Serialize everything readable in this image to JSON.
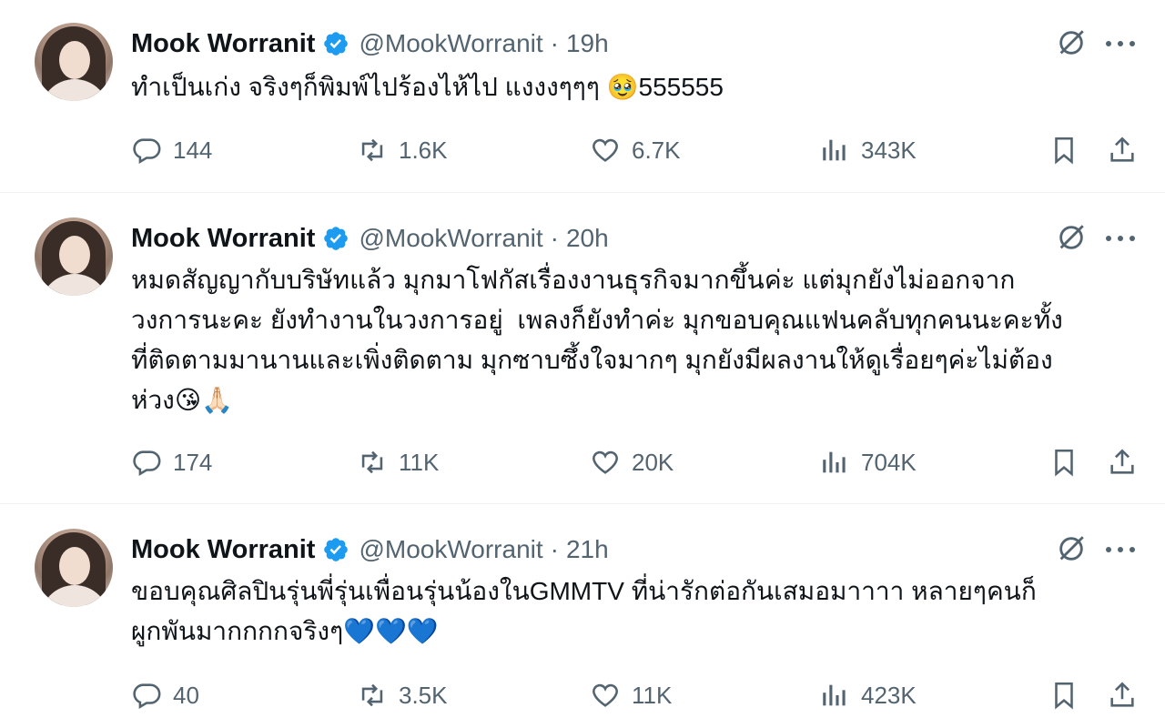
{
  "tweets": [
    {
      "name": "Mook Worranit",
      "handle": "@MookWorranit",
      "separator": "·",
      "time": "19h",
      "text": "ทำเป็นเก่ง จริงๆก็พิมพ์ไปร้องไห้ไป แงงงๆๆๆ 🥹555555",
      "replies": "144",
      "reposts": "1.6K",
      "likes": "6.7K",
      "views": "343K"
    },
    {
      "name": "Mook Worranit",
      "handle": "@MookWorranit",
      "separator": "·",
      "time": "20h",
      "text": "หมดสัญญากับบริษัทแล้ว มุกมาโฟกัสเรื่องงานธุรกิจมากขึ้นค่ะ แต่มุกยังไม่ออกจาก\nวงการนะคะ ยังทำงานในวงการอยู่  เพลงก็ยังทำค่ะ มุกขอบคุณแฟนคลับทุกคนนะคะทั้ง\nที่ติดตามมานานและเพิ่งติดตาม มุกซาบซึ้งใจมากๆ มุกยังมีผลงานให้ดูเรื่อยๆค่ะไม่ต้อง\nห่วง😘🙏🏻",
      "replies": "174",
      "reposts": "11K",
      "likes": "20K",
      "views": "704K"
    },
    {
      "name": "Mook Worranit",
      "handle": "@MookWorranit",
      "separator": "·",
      "time": "21h",
      "text": "ขอบคุณศิลปินรุ่นพี่รุ่นเพื่อนรุ่นน้องในGMMTV ที่น่ารักต่อกันเสมอมาาาา หลายๆคนก็\nผูกพันมากกกกจริงๆ💙💙💙",
      "replies": "40",
      "reposts": "3.5K",
      "likes": "11K",
      "views": "423K"
    }
  ],
  "icons": {
    "verified": "verified-badge-icon",
    "grok": "grok-icon",
    "more": "more-icon",
    "reply": "reply-icon",
    "repost": "repost-icon",
    "like": "heart-icon",
    "views": "views-icon",
    "bookmark": "bookmark-icon",
    "share": "share-icon"
  },
  "colors": {
    "verified": "#1d9bf0",
    "muted": "#536471",
    "text": "#0f1419",
    "divider": "#eff3f4"
  }
}
